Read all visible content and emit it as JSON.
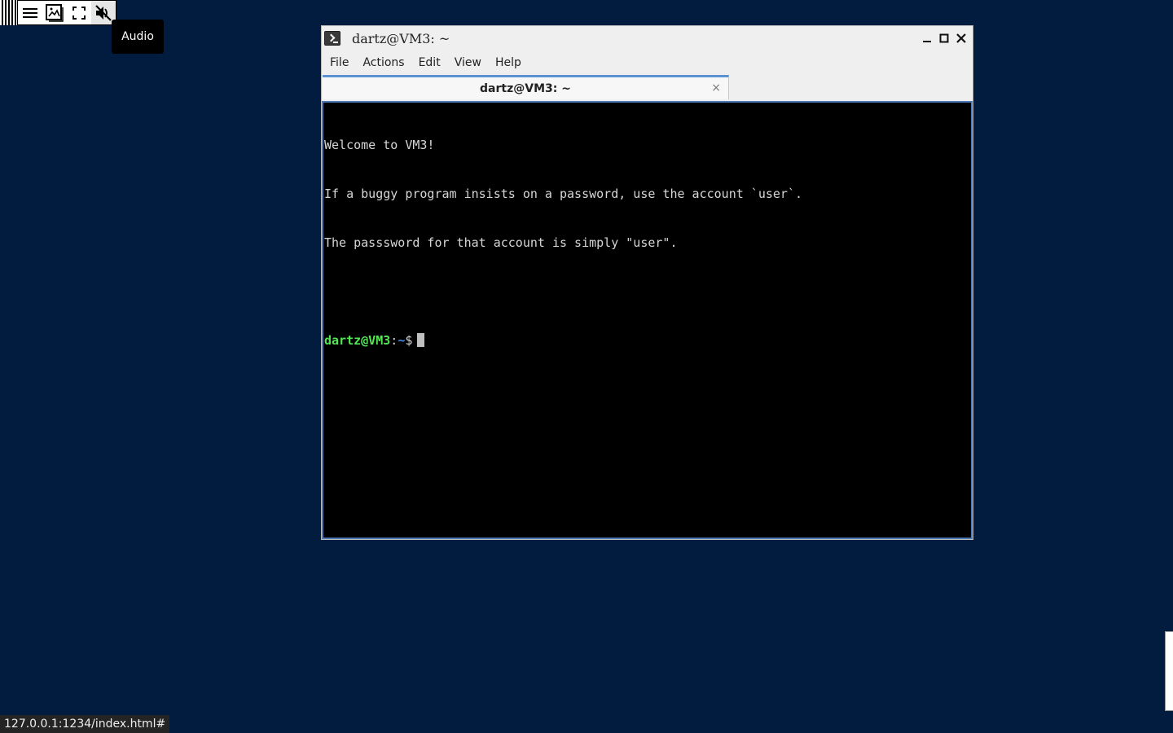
{
  "desktop": {
    "background_color": "#011c3e"
  },
  "controlbar": {
    "buttons": [
      {
        "icon": "menu-icon"
      },
      {
        "icon": "image-icon"
      },
      {
        "icon": "fullscreen-icon"
      },
      {
        "icon": "audio-muted-icon"
      }
    ],
    "tooltip": "Audio"
  },
  "window": {
    "title": "dartz@VM3: ~",
    "menus": [
      "File",
      "Actions",
      "Edit",
      "View",
      "Help"
    ],
    "tab": {
      "label": "dartz@VM3: ~",
      "close": "×"
    },
    "terminal": {
      "lines": [
        "Welcome to VM3!",
        "If a buggy program insists on a password, use the account `user`.",
        "The passsword for that account is simply \"user\".",
        ""
      ],
      "prompt_user": "dartz@VM3",
      "prompt_colon": ":",
      "prompt_path": "~",
      "prompt_symbol": "$"
    }
  },
  "statusbar": {
    "url": "127.0.0.1:1234/index.html#"
  },
  "colors": {
    "tab_accent": "#5b92d3",
    "prompt_user": "#54e554",
    "prompt_path": "#3b8ae6",
    "terminal_bg": "#000000"
  }
}
